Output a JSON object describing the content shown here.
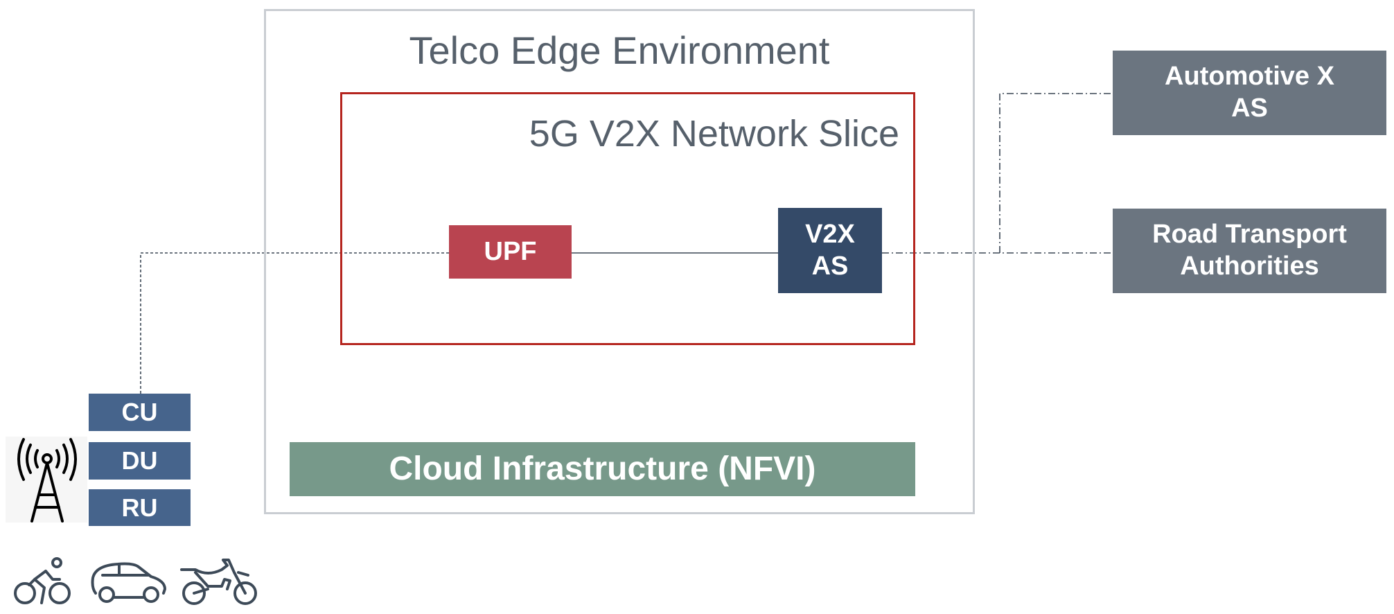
{
  "environment": {
    "title": "Telco Edge Environment"
  },
  "slice": {
    "title": "5G V2X Network Slice"
  },
  "nodes": {
    "upf": "UPF",
    "v2x_as_line1": "V2X",
    "v2x_as_line2": "AS",
    "cloud": "Cloud Infrastructure (NFVI)",
    "automotive_line1": "Automotive X",
    "automotive_line2": "AS",
    "road_line1": "Road Transport",
    "road_line2": "Authorities",
    "cu": "CU",
    "du": "DU",
    "ru": "RU"
  },
  "icons": [
    "radio-tower-icon",
    "bicycle-icon",
    "car-icon",
    "motorbike-icon"
  ],
  "colors": {
    "environment_border": "#c9cdd2",
    "slice_border": "#b5251f",
    "upf": "#b94450",
    "v2x_as": "#344a68",
    "cloud": "#77998a",
    "external": "#6b7580",
    "ran": "#46648c",
    "title_text": "#56606b"
  }
}
